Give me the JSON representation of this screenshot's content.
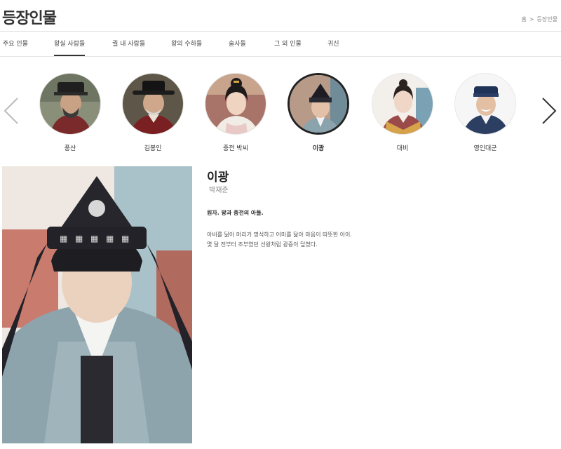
{
  "header": {
    "title": "등장인물"
  },
  "breadcrumb": {
    "home": "홈",
    "separator": ">",
    "current": "등장인물"
  },
  "tabs": [
    {
      "label": "주요 인물",
      "active": false
    },
    {
      "label": "왕실 사람들",
      "active": true
    },
    {
      "label": "궐 내 사람들",
      "active": false
    },
    {
      "label": "왕의 수하들",
      "active": false
    },
    {
      "label": "술사들",
      "active": false
    },
    {
      "label": "그 외 인물",
      "active": false
    },
    {
      "label": "귀신",
      "active": false
    }
  ],
  "carousel": {
    "characters": [
      {
        "name": "풍산",
        "active": false
      },
      {
        "name": "김봉인",
        "active": false
      },
      {
        "name": "중전 박씨",
        "active": false
      },
      {
        "name": "이광",
        "active": true
      },
      {
        "name": "대비",
        "active": false
      },
      {
        "name": "영인대군",
        "active": false
      }
    ],
    "prev_icon": "chevron-left-icon",
    "next_icon": "chevron-right-icon"
  },
  "detail": {
    "name": "이광",
    "actor": "박재준",
    "summary": "원자. 왕과 중전의 아들.",
    "description_lines": [
      "아비를 닮아 머리가 명석하고 어미를 닮아 마음이 따뜻한 아이.",
      "몇 달 전부터 조부였던 선왕처럼 광증이 덮쳤다."
    ]
  },
  "colors": {
    "text": "#222222",
    "muted": "#888888",
    "rule": "#dddddd",
    "active_border": "#222222"
  }
}
